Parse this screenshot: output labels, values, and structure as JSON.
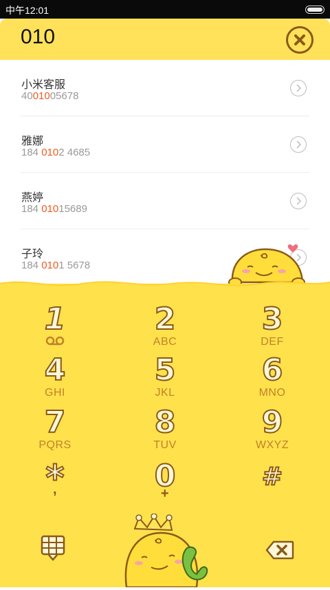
{
  "status": {
    "time": "中午12:01"
  },
  "search": {
    "query": "010"
  },
  "contacts": [
    {
      "name": "小米客服",
      "pre": "40",
      "hl": "010",
      "post": "05678"
    },
    {
      "name": "雅娜",
      "pre": "184 ",
      "hl": "010",
      "post": "2 4685"
    },
    {
      "name": "燕婷",
      "pre": "184 ",
      "hl": "010",
      "post": "15689"
    },
    {
      "name": "子玲",
      "pre": "184 ",
      "hl": "010",
      "post": "1 5678"
    }
  ],
  "keypad": {
    "k1": {
      "digit": "1",
      "letters": ""
    },
    "k2": {
      "digit": "2",
      "letters": "ABC"
    },
    "k3": {
      "digit": "3",
      "letters": "DEF"
    },
    "k4": {
      "digit": "4",
      "letters": "GHI"
    },
    "k5": {
      "digit": "5",
      "letters": "JKL"
    },
    "k6": {
      "digit": "6",
      "letters": "MNO"
    },
    "k7": {
      "digit": "7",
      "letters": "PQRS"
    },
    "k8": {
      "digit": "8",
      "letters": "TUV"
    },
    "k9": {
      "digit": "9",
      "letters": "WXYZ"
    },
    "kstar": {
      "digit": "*",
      "letters": ","
    },
    "k0": {
      "digit": "0",
      "letters": "+"
    },
    "khash": {
      "digit": "#",
      "letters": ""
    }
  },
  "icons": {
    "close": "close-icon",
    "arrow": "chevron-right-icon",
    "voicemail": "voicemail-icon",
    "keypad": "keypad-grid-icon",
    "call": "call-icon",
    "backspace": "backspace-icon"
  },
  "colors": {
    "accent_yellow": "#ffe14c",
    "brown": "#8a5a16",
    "highlight": "#f05b1d",
    "call_green": "#7ac142"
  }
}
